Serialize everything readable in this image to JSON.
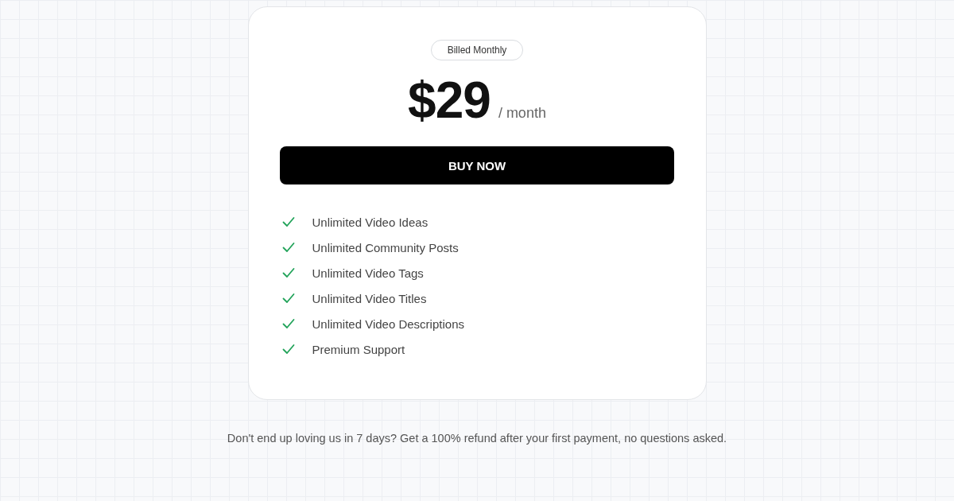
{
  "badge": "Billed Monthly",
  "price": "$29",
  "period": "/ month",
  "button": "BUY NOW",
  "features": [
    "Unlimited Video Ideas",
    "Unlimited Community Posts",
    "Unlimited Video Tags",
    "Unlimited Video Titles",
    "Unlimited Video Descriptions",
    "Premium Support"
  ],
  "note": "Don't end up loving us in 7 days? Get a 100% refund after your first payment, no questions asked."
}
